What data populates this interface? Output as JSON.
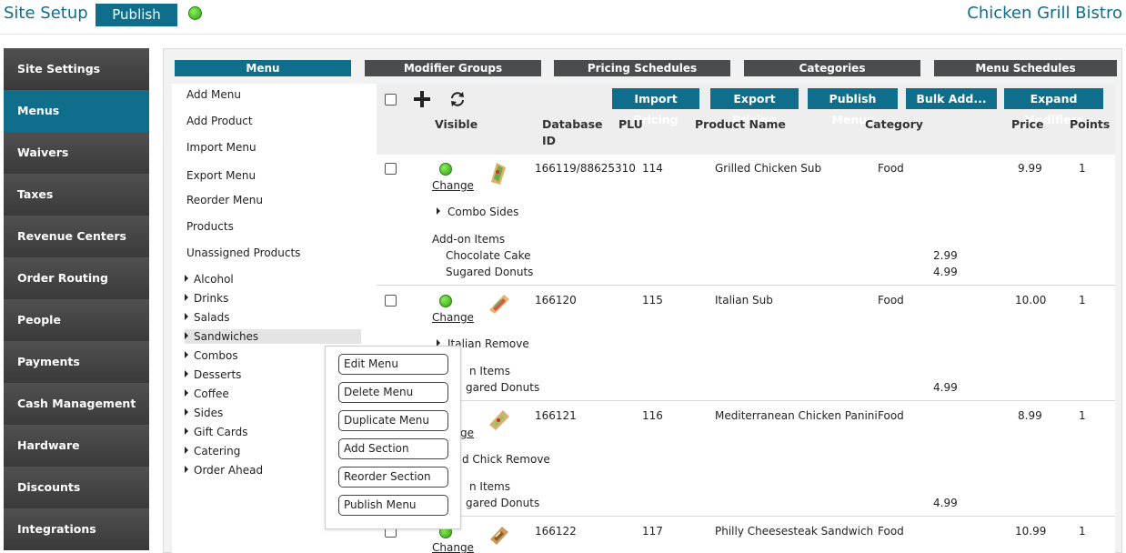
{
  "header": {
    "site_title": "Site Setup",
    "publish_label": "Publish",
    "status_color": "#3cb51e",
    "restaurant_name": "Chicken Grill Bistro"
  },
  "sidebar": {
    "items": [
      {
        "label": "Site Settings"
      },
      {
        "label": "Menus",
        "active": true
      },
      {
        "label": "Waivers"
      },
      {
        "label": "Taxes"
      },
      {
        "label": "Revenue Centers"
      },
      {
        "label": "Order Routing"
      },
      {
        "label": "People"
      },
      {
        "label": "Payments"
      },
      {
        "label": "Cash Management"
      },
      {
        "label": "Hardware"
      },
      {
        "label": "Discounts"
      },
      {
        "label": "Integrations"
      }
    ]
  },
  "tabs": [
    {
      "label": "Menu",
      "active": true
    },
    {
      "label": "Modifier Groups"
    },
    {
      "label": "Pricing Schedules"
    },
    {
      "label": "Categories"
    },
    {
      "label": "Menu Schedules"
    }
  ],
  "menu_actions": [
    {
      "label": "Add Menu"
    },
    {
      "label": "Add Product"
    },
    {
      "label": "Import Menu"
    },
    {
      "label": "Export Menu"
    },
    {
      "label": "Reorder Menu"
    },
    {
      "label": "Products"
    },
    {
      "label": "Unassigned Products"
    }
  ],
  "menu_categories": [
    {
      "label": "Alcohol"
    },
    {
      "label": "Drinks"
    },
    {
      "label": "Salads"
    },
    {
      "label": "Sandwiches",
      "selected": true
    },
    {
      "label": "Combos"
    },
    {
      "label": "Desserts"
    },
    {
      "label": "Coffee"
    },
    {
      "label": "Sides"
    },
    {
      "label": "Gift Cards"
    },
    {
      "label": "Catering"
    },
    {
      "label": "Order Ahead"
    }
  ],
  "toolbar": {
    "add_icon": "plus-icon",
    "refresh_icon": "refresh-icon",
    "buttons": [
      {
        "label": "Import Pricing"
      },
      {
        "label": "Export Pricing"
      },
      {
        "label": "Publish Menus"
      },
      {
        "label": "Bulk Add..."
      },
      {
        "label": "Expand Modifiers"
      }
    ]
  },
  "table": {
    "columns": {
      "visible": "Visible",
      "database": "Database",
      "id": "ID",
      "plu": "PLU",
      "product_name": "Product Name",
      "category": "Category",
      "price": "Price",
      "points": "Points"
    },
    "change_label": "Change",
    "addon_header": "Add-on Items",
    "rows": [
      {
        "db_id": "166119/88625310",
        "plu": "114",
        "name": "Grilled Chicken Sub",
        "category": "Food",
        "price": "9.99",
        "points": "1",
        "modifier": "Combo Sides",
        "addons": [
          {
            "name": "Chocolate Cake",
            "price": "2.99"
          },
          {
            "name": "Sugared Donuts",
            "price": "4.99"
          }
        ]
      },
      {
        "db_id": "166120",
        "plu": "115",
        "name": "Italian Sub",
        "category": "Food",
        "price": "10.00",
        "points": "1",
        "modifier": "Italian Remove",
        "addon_partial": "n Items",
        "addon_partial2": "gared Donuts",
        "addon_price": "4.99"
      },
      {
        "db_id": "166121",
        "plu": "116",
        "name": "Mediterranean Chicken Panini",
        "category": "Food",
        "price": "8.99",
        "points": "1",
        "change_partial": "ge",
        "modifier_partial": "d Chick Remove",
        "addon_partial": "n Items",
        "addon_partial2": "gared Donuts",
        "addon_price": "4.99"
      },
      {
        "db_id": "166122",
        "plu": "117",
        "name": "Philly Cheesesteak Sandwich",
        "category": "Food",
        "price": "10.99",
        "points": "1"
      }
    ]
  },
  "context_menu": {
    "items": [
      {
        "label": "Edit Menu"
      },
      {
        "label": "Delete Menu"
      },
      {
        "label": "Duplicate Menu"
      },
      {
        "label": "Add Section"
      },
      {
        "label": "Reorder Section"
      },
      {
        "label": "Publish Menu"
      }
    ]
  }
}
